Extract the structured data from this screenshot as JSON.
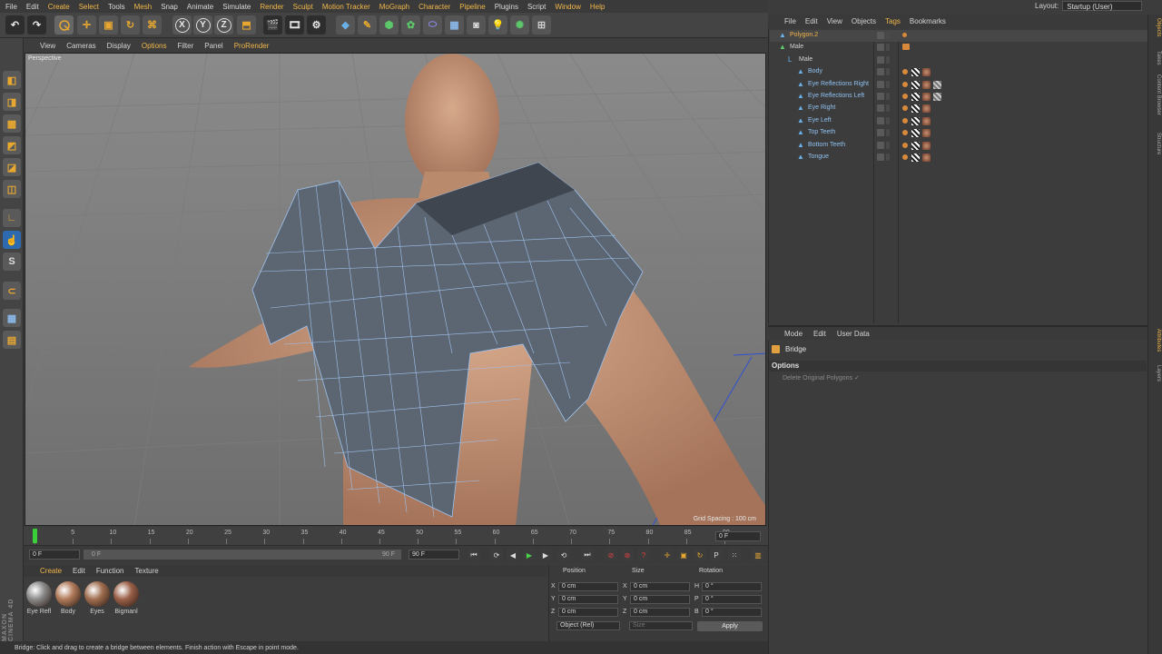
{
  "menubar": {
    "items": [
      "File",
      "Edit",
      "Create",
      "Select",
      "Tools",
      "Mesh",
      "Snap",
      "Animate",
      "Simulate",
      "Render",
      "Sculpt",
      "Motion Tracker",
      "MoGraph",
      "Character",
      "Pipeline",
      "Plugins",
      "Script",
      "Window",
      "Help"
    ],
    "highlighted": [
      "Create",
      "Select",
      "Mesh",
      "Render",
      "Sculpt",
      "Motion Tracker",
      "MoGraph",
      "Character",
      "Pipeline",
      "Window",
      "Help"
    ]
  },
  "layout": {
    "label": "Layout:",
    "value": "Startup (User)"
  },
  "toolbar": {
    "axis_x": "X",
    "axis_y": "Y",
    "axis_z": "Z",
    "icons": [
      "undo-icon",
      "redo-icon",
      "live-selection-icon",
      "move-icon",
      "scale-icon",
      "rotate-icon",
      "recent-tools-icon",
      "x-axis-icon",
      "y-axis-icon",
      "z-axis-icon",
      "world-coordinate-icon",
      "render-view-icon",
      "render-picture-viewer-icon",
      "edit-render-settings-icon",
      "cube-icon",
      "pen-icon",
      "subdivision-icon",
      "cloner-icon",
      "deformer-icon",
      "floor-icon",
      "camera-icon",
      "light-icon",
      "scene-icon",
      "plane-icon"
    ]
  },
  "viewport": {
    "menu": [
      "View",
      "Cameras",
      "Display",
      "Options",
      "Filter",
      "Panel",
      "ProRender"
    ],
    "highlighted": [
      "Options",
      "ProRender"
    ],
    "label": "Perspective",
    "grid_spacing": "Grid Spacing : 100 cm"
  },
  "timeline": {
    "ticks": [
      "0",
      "5",
      "10",
      "15",
      "20",
      "25",
      "30",
      "35",
      "40",
      "45",
      "50",
      "55",
      "60",
      "65",
      "70",
      "75",
      "80",
      "85",
      "90"
    ],
    "current_frame_field": "0 F",
    "start_field": "0 F",
    "range_start": "0 F",
    "range_end": "90 F",
    "end_field": "90 F"
  },
  "materials": {
    "menu": [
      "Create",
      "Edit",
      "Function",
      "Texture"
    ],
    "highlighted": [
      "Create"
    ],
    "items": [
      {
        "name": "Eye Refl",
        "color": "#8a8a8a"
      },
      {
        "name": "Body",
        "color": "#b07a5a"
      },
      {
        "name": "Eyes",
        "color": "#a06e50"
      },
      {
        "name": "Bigmanl",
        "color": "#9a6048"
      }
    ]
  },
  "coordinates": {
    "headers": {
      "position": "Position",
      "size": "Size",
      "rotation": "Rotation"
    },
    "rows": [
      {
        "axis": "X",
        "pos": "0 cm",
        "size_axis": "X",
        "size": "0 cm",
        "rot_axis": "H",
        "rot": "0 °"
      },
      {
        "axis": "Y",
        "pos": "0 cm",
        "size_axis": "Y",
        "size": "0 cm",
        "rot_axis": "P",
        "rot": "0 °"
      },
      {
        "axis": "Z",
        "pos": "0 cm",
        "size_axis": "Z",
        "size": "0 cm",
        "rot_axis": "B",
        "rot": "0 °"
      }
    ],
    "mode": "Object (Rel)",
    "size_mode": "Size",
    "apply": "Apply"
  },
  "status": "Bridge: Click and drag to create a bridge between elements. Finish action with Escape in point mode.",
  "brand": "MAXON CINEMA 4D",
  "objects": {
    "menu": [
      "File",
      "Edit",
      "View",
      "Objects",
      "Tags",
      "Bookmarks"
    ],
    "highlighted": [
      "Tags"
    ],
    "rows": [
      {
        "name": "Polygon.2",
        "indent": 0,
        "selected": true,
        "color": "#f0b64a"
      },
      {
        "name": "Male",
        "indent": 0,
        "selected": false,
        "color": "#d3d3d3"
      },
      {
        "name": "Male",
        "indent": 1,
        "selected": false,
        "color": "#d3d3d3"
      },
      {
        "name": "Body",
        "indent": 2,
        "selected": false,
        "color": "#8fc0f0"
      },
      {
        "name": "Eye Reflections Right",
        "indent": 2,
        "selected": false,
        "color": "#8fc0f0"
      },
      {
        "name": "Eye Reflections Left",
        "indent": 2,
        "selected": false,
        "color": "#8fc0f0"
      },
      {
        "name": "Eye Right",
        "indent": 2,
        "selected": false,
        "color": "#8fc0f0"
      },
      {
        "name": "Eye Left",
        "indent": 2,
        "selected": false,
        "color": "#8fc0f0"
      },
      {
        "name": "Top Teeth",
        "indent": 2,
        "selected": false,
        "color": "#8fc0f0"
      },
      {
        "name": "Bottom Teeth",
        "indent": 2,
        "selected": false,
        "color": "#8fc0f0"
      },
      {
        "name": "Tongue",
        "indent": 2,
        "selected": false,
        "color": "#8fc0f0"
      }
    ]
  },
  "attributes": {
    "menu": [
      "Mode",
      "Edit",
      "User Data"
    ],
    "title": "Bridge",
    "section": "Options",
    "option": "Delete Original Polygons ✓"
  },
  "right_tabs": [
    "Objects",
    "Takes",
    "Content Browser",
    "Structure",
    "Attributes",
    "Layers"
  ],
  "colors": {
    "accent": "#f0b64a",
    "selection_blue": "#6ab0e8",
    "mesh": "#5c6672"
  }
}
